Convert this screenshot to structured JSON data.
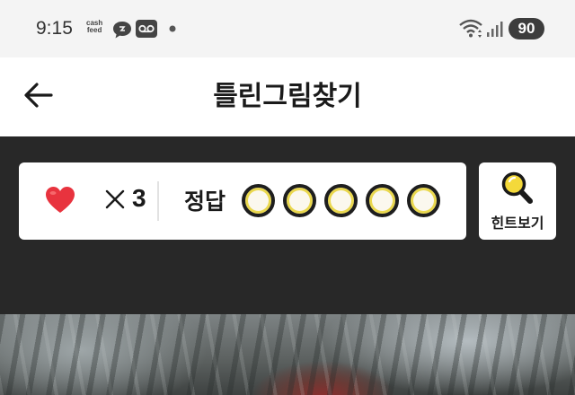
{
  "status_bar": {
    "time": "9:15",
    "cashfeed_line1": "cash",
    "cashfeed_line2": "feed",
    "battery": "90",
    "icons": [
      "cashfeed-icon",
      "chat-bubble-icon",
      "voicemail-icon",
      "dot-icon",
      "wifi-icon",
      "signal-icon"
    ]
  },
  "app_bar": {
    "title": "틀린그림찾기",
    "back_icon": "arrow-left-icon"
  },
  "score_card": {
    "lives_icon": "heart-icon",
    "times_icon": "times-icon",
    "lives_count": "3",
    "answer_label": "정답",
    "answer_slots": 5,
    "answers_found": 0
  },
  "hint_button": {
    "label": "힌트보기",
    "icon": "magnifier-icon"
  },
  "colors": {
    "panel_bg": "#282828",
    "heart": "#e8333e",
    "slot_ring": "#ead84e",
    "hint_lens": "#f4d93a"
  }
}
